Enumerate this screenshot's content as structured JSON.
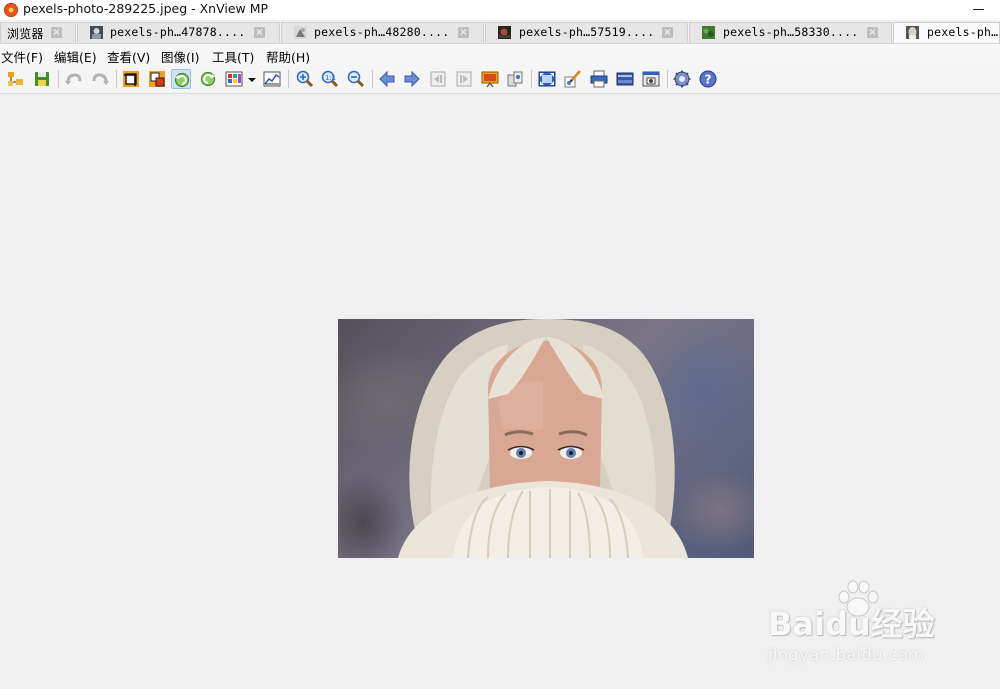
{
  "window": {
    "title": "pexels-photo-289225.jpeg - XnView MP"
  },
  "tabs": [
    {
      "label": "浏览器",
      "active": false
    },
    {
      "label": "pexels-ph…47878....",
      "active": false
    },
    {
      "label": "pexels-ph…48280....",
      "active": false
    },
    {
      "label": "pexels-ph…57519....",
      "active": false
    },
    {
      "label": "pexels-ph…58330....",
      "active": false
    },
    {
      "label": "pexels-ph…",
      "active": true
    }
  ],
  "menu": [
    "文件(F)",
    "编辑(E)",
    "查看(V)",
    "图像(I)",
    "工具(T)",
    "帮助(H)"
  ],
  "toolbar": {
    "icons": [
      "open-folder-icon",
      "save-icon",
      "undo-icon",
      "redo-icon",
      "crop-icon",
      "resize-icon",
      "rotate-left-icon",
      "rotate-right-icon",
      "color-adjust-icon",
      "dropdown-arrow-icon",
      "histogram-icon",
      "zoom-in-icon",
      "zoom-fit-icon",
      "zoom-out-icon",
      "previous-icon",
      "next-icon",
      "first-page-icon",
      "last-page-icon",
      "slideshow-icon",
      "compare-icon",
      "fullscreen-icon",
      "edit-paint-icon",
      "print-icon",
      "scan-icon",
      "capture-icon",
      "settings-icon",
      "help-icon"
    ]
  },
  "watermark": {
    "main": "Baidu经验",
    "sub": "jingyan.baidu.com"
  }
}
